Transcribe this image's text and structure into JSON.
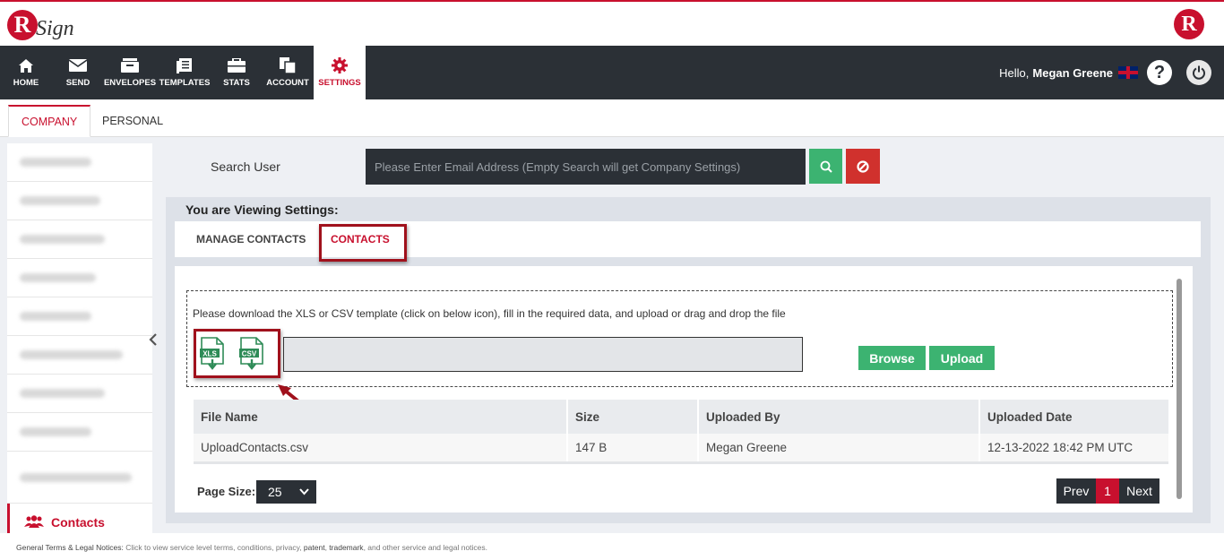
{
  "brand": {
    "logo_letter": "R",
    "logo_text": "Sign"
  },
  "nav": {
    "items": [
      {
        "label": "HOME",
        "icon": "home-icon"
      },
      {
        "label": "SEND",
        "icon": "envelope-icon"
      },
      {
        "label": "ENVELOPES",
        "icon": "envelopes-icon"
      },
      {
        "label": "TEMPLATES",
        "icon": "templates-icon"
      },
      {
        "label": "STATS",
        "icon": "briefcase-icon"
      },
      {
        "label": "ACCOUNT",
        "icon": "copy-icon"
      },
      {
        "label": "SETTINGS",
        "icon": "gear-icon"
      }
    ],
    "greeting": "Hello,",
    "user_name": "Megan Greene",
    "help": "?"
  },
  "subtabs": {
    "company": "COMPANY",
    "personal": "PERSONAL"
  },
  "sidebar": {
    "active_item": "Contacts"
  },
  "search": {
    "label": "Search User",
    "placeholder": "Please Enter Email Address (Empty Search will get Company Settings)"
  },
  "panel": {
    "viewing_label": "You are Viewing Settings:",
    "tabs": {
      "manage_contacts": "MANAGE CONTACTS",
      "contacts": "CONTACTS"
    }
  },
  "upload": {
    "instructions": "Please download the XLS or CSV template (click on below icon), fill in the required data, and upload or drag and drop the file",
    "xls_label": "XLS",
    "csv_label": "CSV",
    "browse": "Browse",
    "upload": "Upload"
  },
  "table": {
    "headers": [
      "File Name",
      "Size",
      "Uploaded By",
      "Uploaded Date"
    ],
    "rows": [
      [
        "UploadContacts.csv",
        "147 B",
        "Megan Greene",
        "12-13-2022 18:42 PM UTC"
      ]
    ]
  },
  "pagination": {
    "page_size_label": "Page Size:",
    "page_size": "25",
    "prev": "Prev",
    "current": "1",
    "next": "Next"
  },
  "footer": {
    "title": "General Terms & Legal Notices:",
    "text1": " Click to view service level terms, conditions, privacy, ",
    "patent": "patent",
    "sep": ", ",
    "trademark": "trademark",
    "text2": ", and other service and legal notices."
  },
  "colors": {
    "brand_red": "#c8102e",
    "nav_dark": "#2b3036",
    "green": "#3cb371"
  }
}
